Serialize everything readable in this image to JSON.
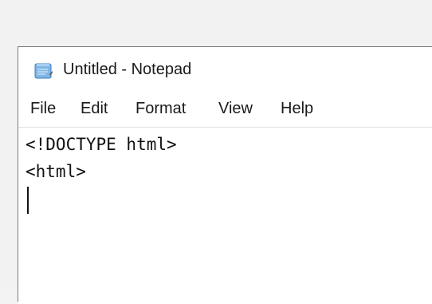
{
  "window": {
    "title": "Untitled - Notepad",
    "icon": "notepad-icon"
  },
  "menu": {
    "file": "File",
    "edit": "Edit",
    "format": "Format",
    "view": "View",
    "help": "Help"
  },
  "editor": {
    "lines": [
      "<!DOCTYPE html>",
      "<html>"
    ]
  }
}
